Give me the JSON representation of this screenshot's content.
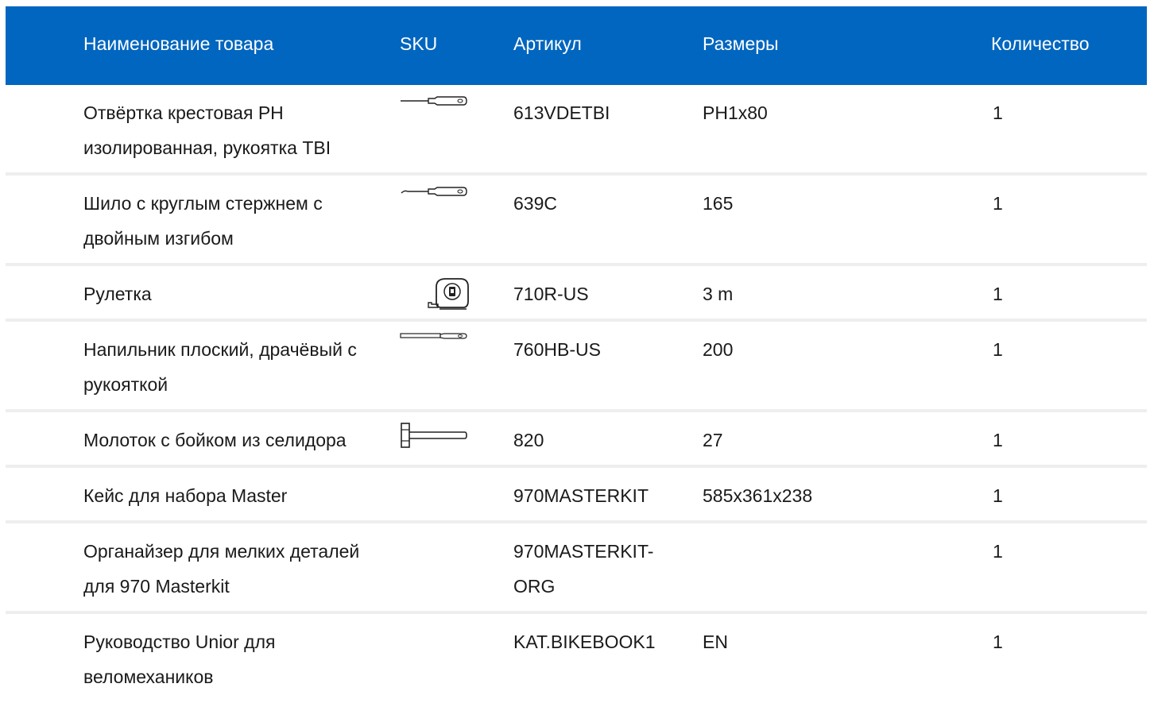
{
  "header": {
    "name": "Наименование товара",
    "sku": "SKU",
    "article": "Артикул",
    "size": "Размеры",
    "quantity": "Количество"
  },
  "rows": [
    {
      "name": "Отвёртка крестовая PH изолированная, рукоятка TBI",
      "icon": "screwdriver-icon",
      "article": "613VDETBI",
      "size": "PH1x80",
      "quantity": "1"
    },
    {
      "name": "Шило с круглым стержнем с двойным изгибом",
      "icon": "awl-icon",
      "article": "639C",
      "size": "165",
      "quantity": "1"
    },
    {
      "name": "Рулетка",
      "icon": "tape-measure-icon",
      "article": "710R-US",
      "size": "3 m",
      "quantity": "1"
    },
    {
      "name": "Напильник плоский, драчёвый с рукояткой",
      "icon": "file-icon",
      "article": "760HB-US",
      "size": "200",
      "quantity": "1"
    },
    {
      "name": "Молоток с бойком из селидора",
      "icon": "hammer-icon",
      "article": "820",
      "size": "27",
      "quantity": "1"
    },
    {
      "name": "Кейс для набора Master",
      "icon": "",
      "article": "970MASTERKIT",
      "size": "585x361x238",
      "quantity": "1"
    },
    {
      "name": "Органайзер для мелких деталей для 970 Masterkit",
      "icon": "",
      "article": "970MASTERKIT-ORG",
      "size": "",
      "quantity": "1"
    },
    {
      "name": "Руководство Unior для веломехаников",
      "icon": "",
      "article": "KAT.BIKEBOOK1",
      "size": "EN",
      "quantity": "1"
    }
  ],
  "colors": {
    "header_bg": "#0066bf",
    "header_text": "#ffffff",
    "row_divider": "#eeeeee"
  }
}
